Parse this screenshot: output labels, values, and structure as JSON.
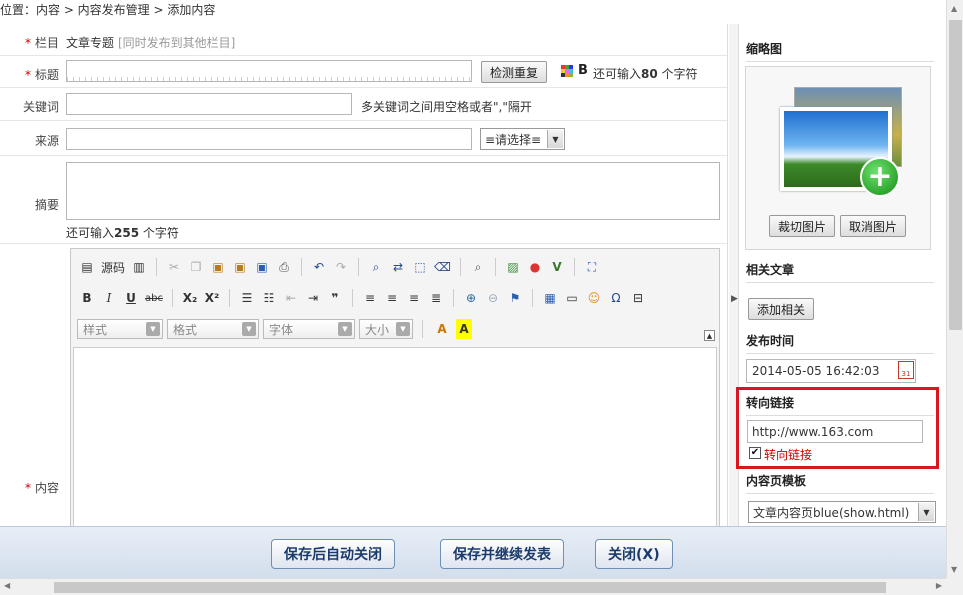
{
  "breadcrumb": "位置：内容 > 内容发布管理 > 添加内容",
  "form": {
    "column": {
      "label": "栏目",
      "value": "文章专题",
      "link": "[同时发布到其他栏目]"
    },
    "title": {
      "label": "标题",
      "check_button": "检测重复",
      "bold_icon": "B",
      "hint_pre": "还可输入",
      "hint_count": "80",
      "hint_post": "个字符"
    },
    "keywords": {
      "label": "关键词",
      "hint": "多关键词之间用空格或者\",\"隔开"
    },
    "source": {
      "label": "来源",
      "select_value": "≡请选择≡"
    },
    "summary": {
      "label": "摘要",
      "hint_pre": "还可输入",
      "hint_count": "255",
      "hint_post": "个字符"
    },
    "content": {
      "label": "内容"
    }
  },
  "editor": {
    "toolbar1": {
      "source_label": "源码"
    },
    "toolbar2": {
      "bold": "B",
      "italic": "I",
      "underline": "U",
      "strike": "abc",
      "sub": "X₂",
      "sup": "X²",
      "quote": "❞"
    },
    "toolbar3": {
      "style": "样式",
      "format": "格式",
      "font": "字体",
      "size": "大小",
      "text_color": "A",
      "bg_color": "A"
    }
  },
  "side": {
    "thumbnail": {
      "title": "缩略图",
      "crop_button": "裁切图片",
      "cancel_button": "取消图片"
    },
    "related": {
      "title": "相关文章",
      "add_button": "添加相关"
    },
    "publish_time": {
      "title": "发布时间",
      "value": "2014-05-05 16:42:03",
      "calendar_day": "31"
    },
    "redirect": {
      "title": "转向链接",
      "url": "http://www.163.com",
      "checkbox_label": "转向链接",
      "checked": true
    },
    "template": {
      "title": "内容页模板",
      "value": "文章内容页blue(show.html)"
    }
  },
  "actions": {
    "save_close": "保存后自动关闭",
    "save_continue": "保存并继续发表",
    "close": "关闭(X)"
  },
  "colors": {
    "required": "#cc0000",
    "highlight": "#d9161f",
    "button_text": "#1a3b6b"
  }
}
